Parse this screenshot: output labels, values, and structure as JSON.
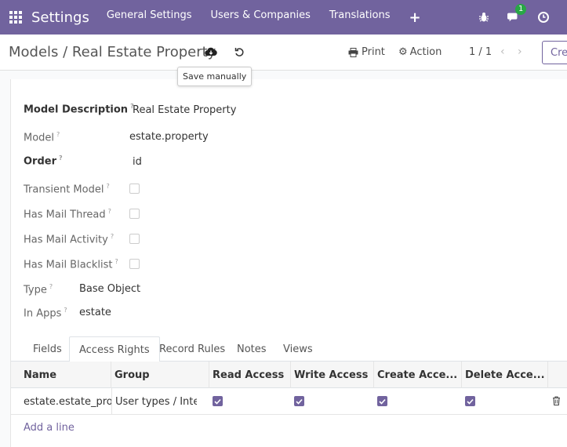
{
  "topnav": {
    "brand": "Settings",
    "menu": [
      "General Settings",
      "Users & Companies",
      "Translations"
    ],
    "plus": "+",
    "chat_badge": "1"
  },
  "control": {
    "breadcrumb": "Models / Real Estate Property",
    "tooltip": "Save manually",
    "print": "Print",
    "action": "Action",
    "pager": "1 / 1",
    "create": "Create"
  },
  "form": {
    "model_description_label": "Model Description",
    "model_description_value": "Real Estate Property",
    "model_label": "Model",
    "model_value": "estate.property",
    "order_label": "Order",
    "order_value": "id",
    "transient_label": "Transient Model",
    "mail_thread_label": "Has Mail Thread",
    "mail_activity_label": "Has Mail Activity",
    "mail_blacklist_label": "Has Mail Blacklist",
    "type_label": "Type",
    "type_value": "Base Object",
    "in_apps_label": "In Apps",
    "in_apps_value": "estate",
    "help_mark": "?"
  },
  "tabs": [
    "Fields",
    "Access Rights",
    "Record Rules",
    "Notes",
    "Views"
  ],
  "table": {
    "headers": [
      "Name",
      "Group",
      "Read Access",
      "Write Access",
      "Create Acce...",
      "Delete Acce..."
    ],
    "rows": [
      {
        "name": "estate.estate_property",
        "group": "User types / Internal User",
        "read": true,
        "write": true,
        "create": true,
        "delete": true
      }
    ],
    "add_line": "Add a line"
  }
}
